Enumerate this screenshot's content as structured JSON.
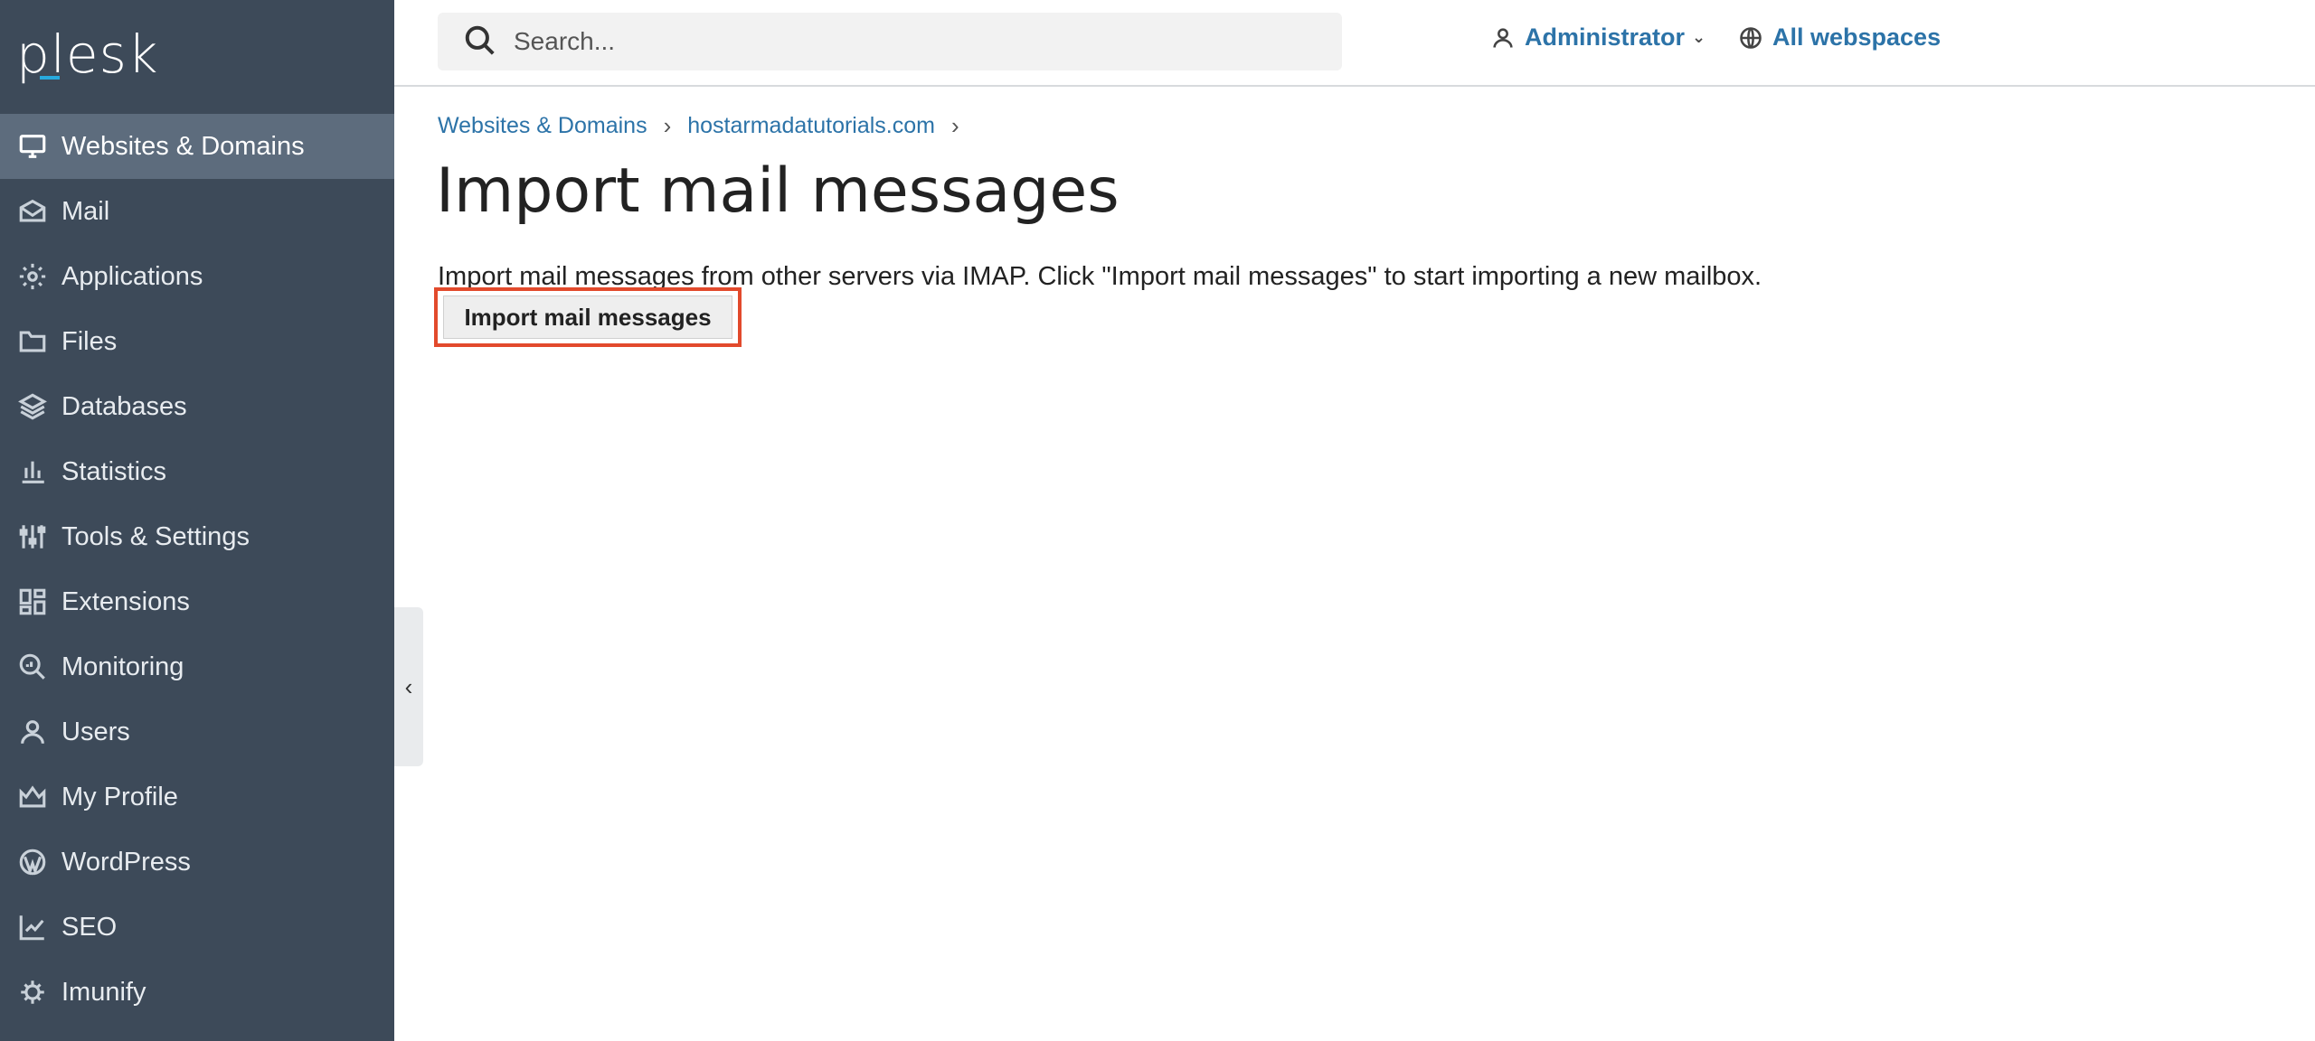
{
  "app": {
    "logo": "plesk"
  },
  "sidebar": {
    "items": [
      {
        "label": "Websites & Domains",
        "icon": "monitor-icon",
        "active": true
      },
      {
        "label": "Mail",
        "icon": "envelope-icon"
      },
      {
        "label": "Applications",
        "icon": "gear-icon"
      },
      {
        "label": "Files",
        "icon": "folder-icon"
      },
      {
        "label": "Databases",
        "icon": "layers-icon"
      },
      {
        "label": "Statistics",
        "icon": "bar-chart-icon"
      },
      {
        "label": "Tools & Settings",
        "icon": "sliders-icon"
      },
      {
        "label": "Extensions",
        "icon": "grid-icon"
      },
      {
        "label": "Monitoring",
        "icon": "magnifier-chart-icon"
      },
      {
        "label": "Users",
        "icon": "user-icon"
      },
      {
        "label": "My Profile",
        "icon": "crown-icon"
      },
      {
        "label": "WordPress",
        "icon": "wordpress-icon"
      },
      {
        "label": "SEO",
        "icon": "seo-chart-icon"
      },
      {
        "label": "Imunify",
        "icon": "imunify-gear-icon"
      }
    ]
  },
  "header": {
    "search_placeholder": "Search...",
    "user_label": "Administrator",
    "webspaces_label": "All webspaces"
  },
  "breadcrumb": {
    "items": [
      "Websites & Domains",
      "hostarmadatutorials.com"
    ]
  },
  "main": {
    "title": "Import mail messages",
    "description": "Import mail messages from other servers via IMAP. Click \"Import mail messages\" to start importing a new mailbox.",
    "button_label": "Import mail messages"
  },
  "colors": {
    "sidebar_bg": "#3d4a59",
    "sidebar_active": "#5d6c7d",
    "link": "#2c73a8",
    "highlight": "#e24a2c"
  }
}
